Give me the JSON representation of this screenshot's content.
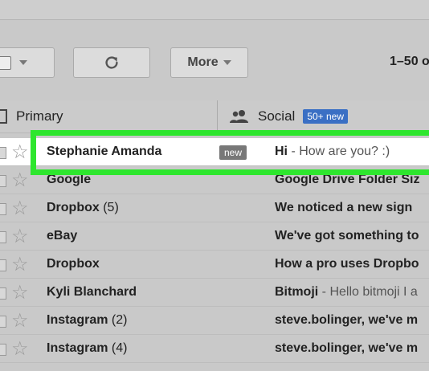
{
  "toolbar": {
    "more_label": "More",
    "pager_text": "1–50 o"
  },
  "tabs": [
    {
      "label": "Primary",
      "icon": "inbox-icon"
    },
    {
      "label": "Social",
      "icon": "people-icon",
      "badge": "50+ new"
    }
  ],
  "emails": [
    {
      "sender": "Stephanie Amanda",
      "count": "",
      "tag": "new",
      "subject": "Hi",
      "snippet": " - How are you? :)",
      "selected": true
    },
    {
      "sender": "Google",
      "count": "",
      "tag": "",
      "subject": "Google Drive Folder Siz",
      "snippet": ""
    },
    {
      "sender": "Dropbox",
      "count": " (5)",
      "tag": "",
      "subject": "We noticed a new sign",
      "snippet": ""
    },
    {
      "sender": "eBay",
      "count": "",
      "tag": "",
      "subject": "We've got something to",
      "snippet": ""
    },
    {
      "sender": "Dropbox",
      "count": "",
      "tag": "",
      "subject": "How a pro uses Dropbo",
      "snippet": ""
    },
    {
      "sender": "Kyli Blanchard",
      "count": "",
      "tag": "",
      "subject": "Bitmoji",
      "snippet": " - Hello bitmoji I a"
    },
    {
      "sender": "Instagram",
      "count": " (2)",
      "tag": "",
      "subject": "steve.bolinger, we've m",
      "snippet": ""
    },
    {
      "sender": "Instagram",
      "count": " (4)",
      "tag": "",
      "subject": "steve.bolinger, we've m",
      "snippet": ""
    }
  ],
  "colors": {
    "highlight": "#2ee62e",
    "badge": "#3a6fc4"
  }
}
